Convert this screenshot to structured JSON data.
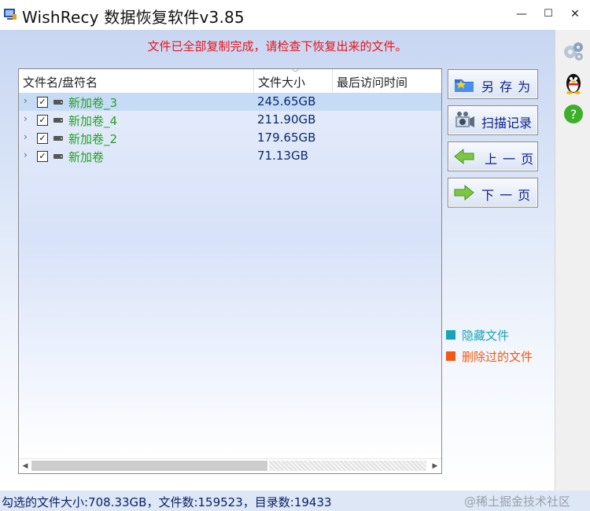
{
  "window": {
    "title": "WishRecy 数据恢复软件v3.85",
    "minimize_glyph": "—",
    "maximize_glyph": "☐",
    "close_glyph": "✕"
  },
  "message": "文件已全部复制完成，请检查下恢复出来的文件。",
  "list": {
    "columns": [
      "文件名/盘符名",
      "文件大小",
      "最后访问时间"
    ],
    "rows": [
      {
        "name": "新加卷_3",
        "size": "245.65GB",
        "checked": true,
        "selected": true
      },
      {
        "name": "新加卷_4",
        "size": "211.90GB",
        "checked": true,
        "selected": false
      },
      {
        "name": "新加卷_2",
        "size": "179.65GB",
        "checked": true,
        "selected": false
      },
      {
        "name": "新加卷",
        "size": "71.13GB",
        "checked": true,
        "selected": false
      }
    ]
  },
  "buttons": {
    "save_as": "另 存 为",
    "scan_records": "扫描记录",
    "prev_page": "上 一 页",
    "next_page": "下 一 页"
  },
  "legend": {
    "hidden_files": {
      "label": "隐藏文件",
      "color": "#1aa3b8"
    },
    "deleted_files": {
      "label": "删除过的文件",
      "color": "#f05a14"
    }
  },
  "status": {
    "text": "勾选的文件大小:708.33GB，文件数:159523，目录数:19433",
    "watermark": "@稀土掘金技术社区"
  },
  "icons": {
    "app": "app-logo-icon",
    "side": [
      "settings-gears-icon",
      "qq-penguin-icon",
      "help-icon"
    ]
  },
  "colors": {
    "message": "#e8141b",
    "volume_name": "#22a322",
    "button_text": "#0b1f8a",
    "selected_row": "#c6dbf6"
  }
}
